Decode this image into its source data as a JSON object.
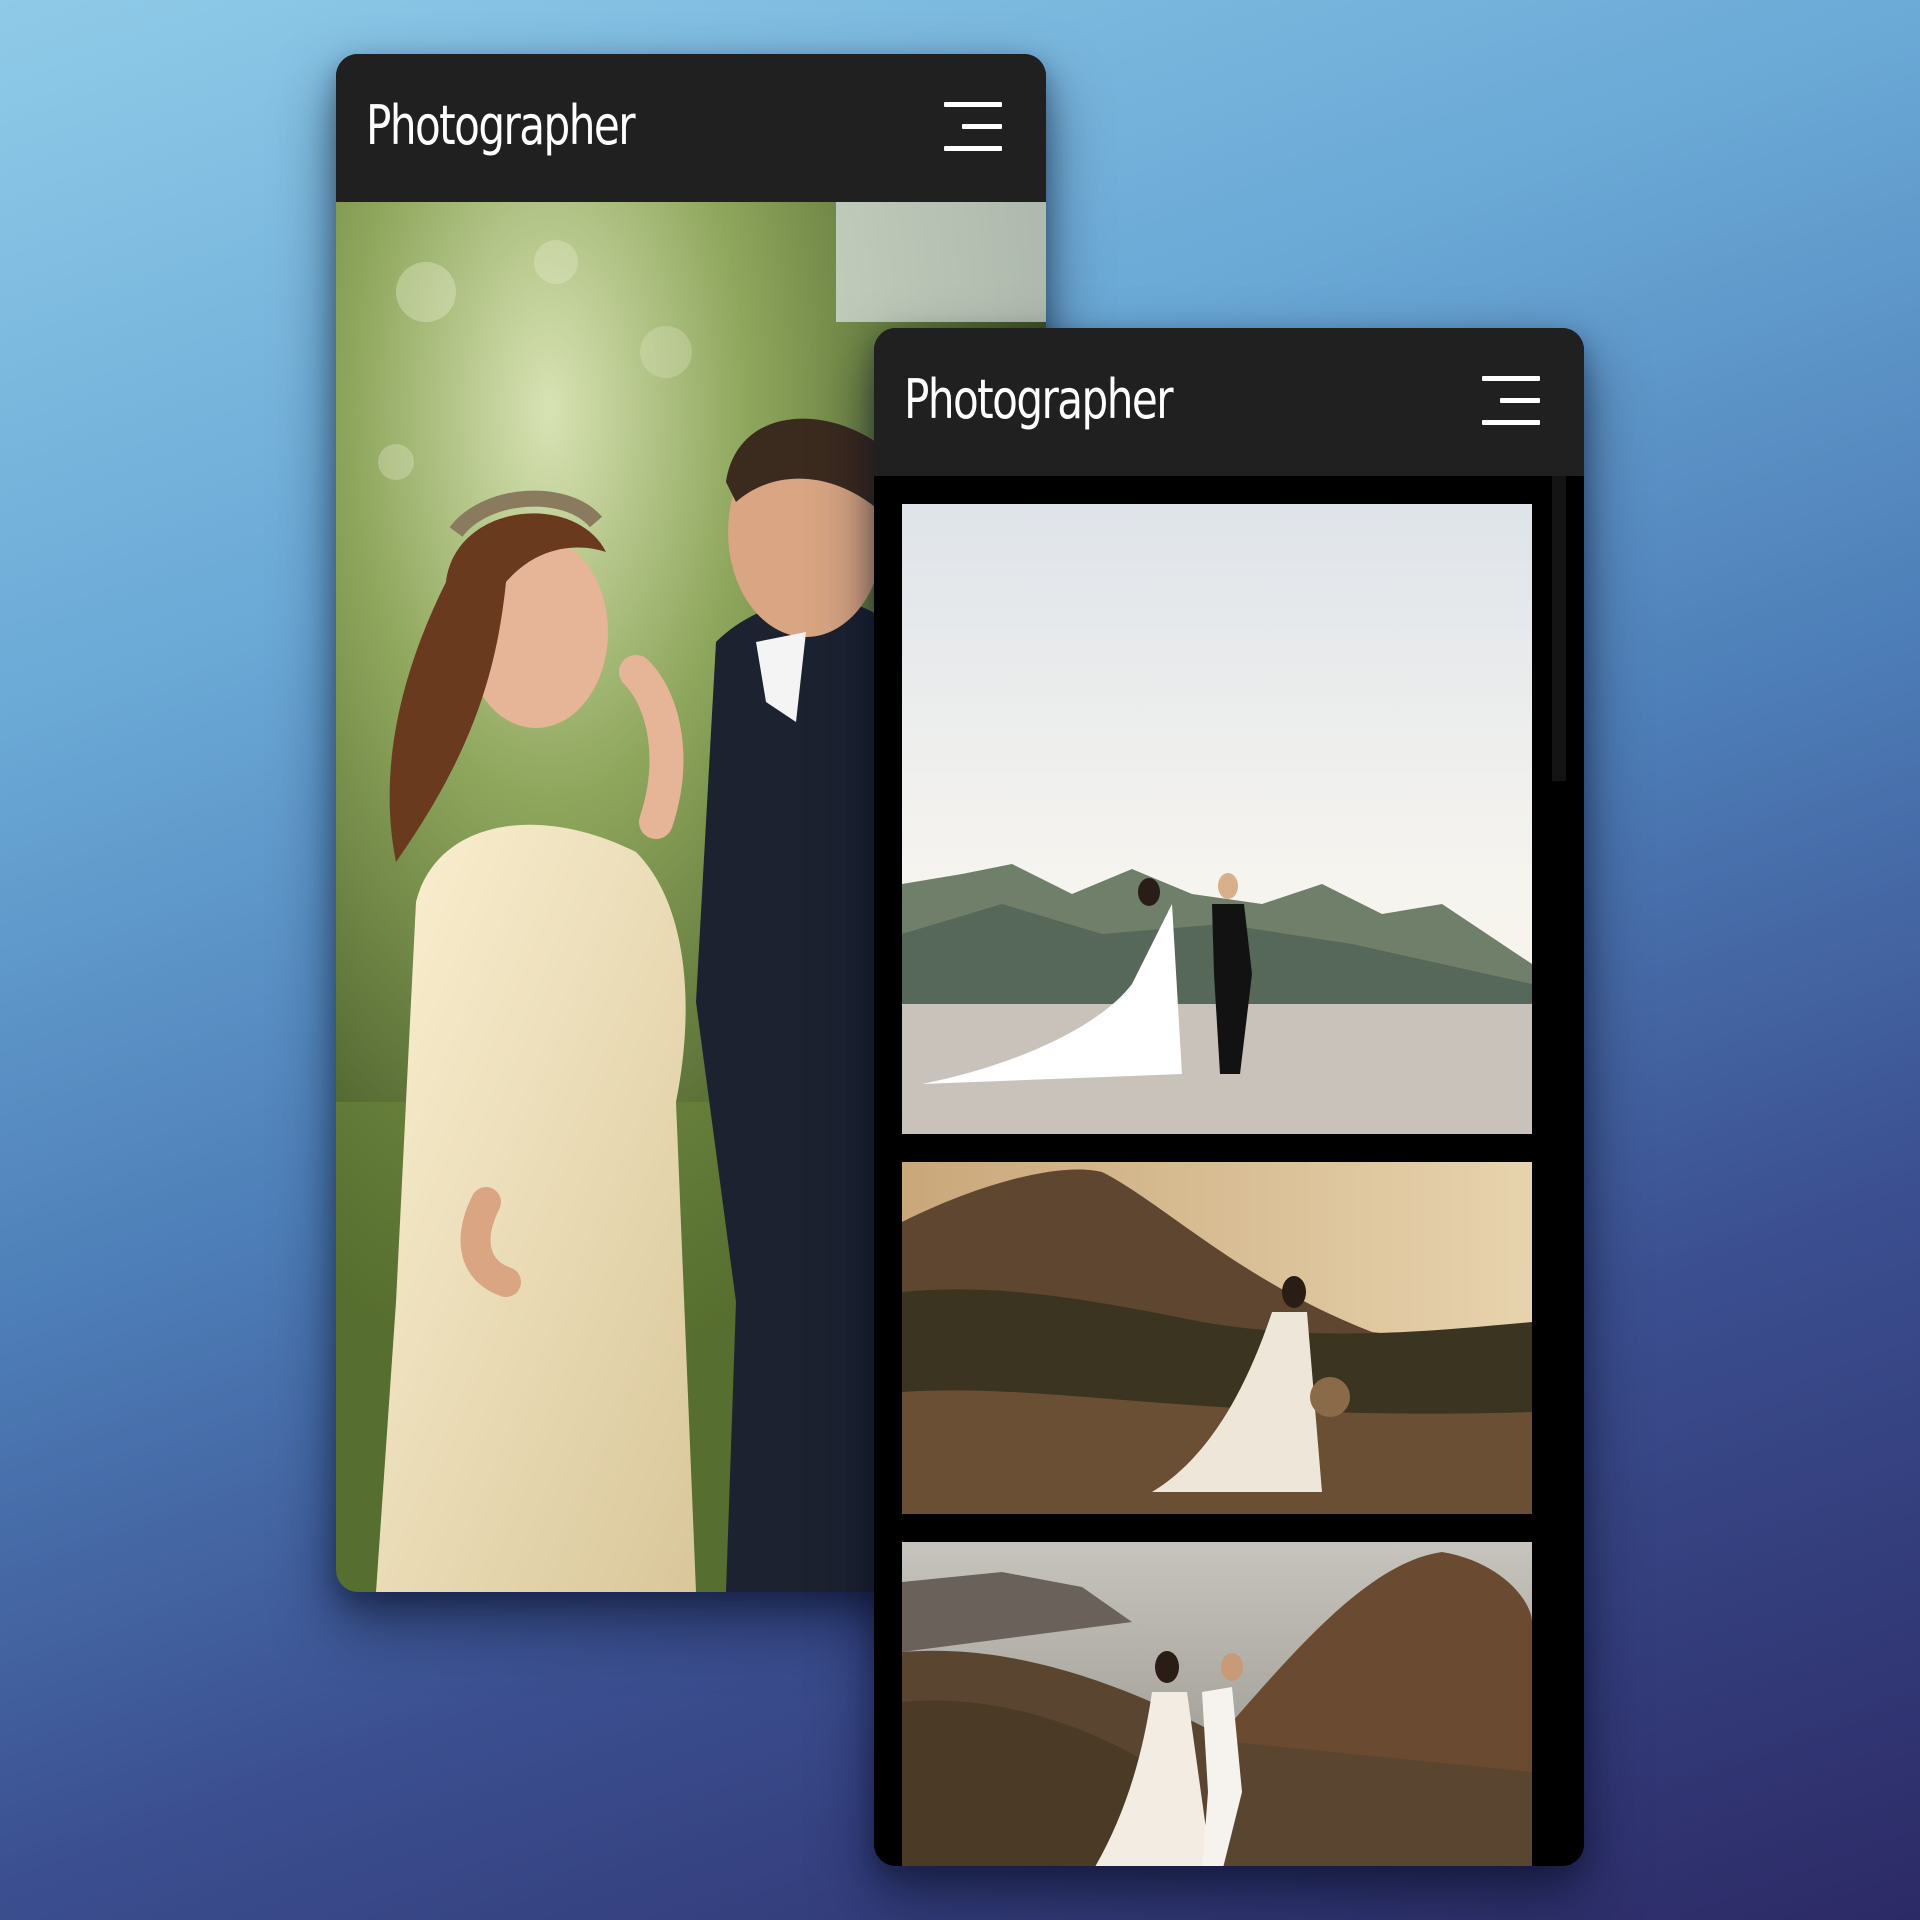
{
  "back_screen": {
    "brand": "Photographer",
    "menu_icon": "hamburger-menu-icon",
    "hero_image": "couple-kiss-photo"
  },
  "front_screen": {
    "brand": "Photographer",
    "menu_icon": "hamburger-menu-icon",
    "gallery": [
      {
        "image": "couple-walking-mountain-photo"
      },
      {
        "image": "bride-on-hill-photo"
      },
      {
        "image": "couple-running-hillside-photo"
      }
    ]
  },
  "colors": {
    "appbar": "#202020",
    "text": "#ffffff",
    "gallery_bg": "#000000"
  }
}
